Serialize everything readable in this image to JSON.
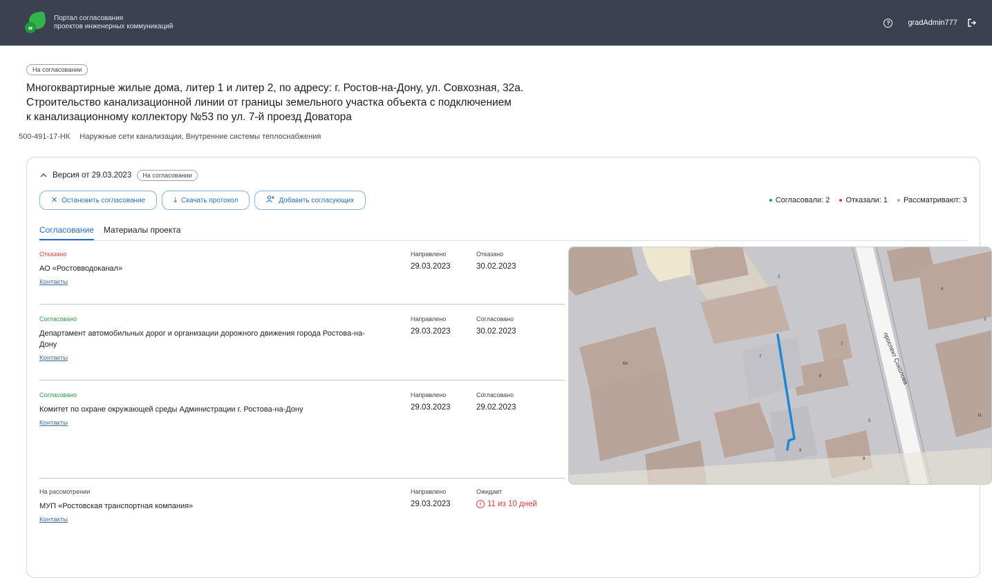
{
  "header": {
    "brand_line1": "Портал согласования",
    "brand_line2": "проектов инженерных коммуникаций",
    "logo_letter": "м",
    "username": "gradAdmin777",
    "icons": [
      "help-icon",
      "logout-icon"
    ]
  },
  "project": {
    "status": "На согласовании",
    "title_line1": "Многоквартирные жилые дома, литер 1 и литер 2, по адресу: г. Ростов-на-Дону, ул. Совхозная, 32а.",
    "title_line2": "Строительство канализационной линии от границы земельного участка объекта с подключением",
    "title_line3": "к канализационному коллектору №53 по ул. 7-й проезд Доватора",
    "code": "500-491-17-НК",
    "systems": "Наружные сети канализации, Внутренние системы теплоснабжения"
  },
  "version": {
    "label": "Версия от 29.03.2023",
    "status": "На согласовании",
    "actions": {
      "stop": "Остановить согласование",
      "download": "Скачать протокол",
      "add": "Добавить согласующих"
    },
    "stats": {
      "approved": "Согласовали: 2",
      "rejected": "Отказали: 1",
      "reviewing": "Рассматривают: 3"
    },
    "colors": {
      "approved": "#2a9d45",
      "rejected": "#e03b3b",
      "reviewing": "#8fb3da",
      "accent": "#1f6fc2"
    }
  },
  "tabs": [
    {
      "label": "Согласование"
    },
    {
      "label": "Материалы проекта"
    }
  ],
  "approvals": [
    {
      "status": "Отказано",
      "status_color": "#e03b3b",
      "org": "АО «Ростовводоканал»",
      "contacts": "Контакты",
      "sent_label": "Направлено",
      "sent": "29.03.2023",
      "result_label": "Отказано",
      "result": "30.02.2023"
    },
    {
      "status": "Согласовано",
      "status_color": "#2a9d45",
      "org": "Департамент автомобильных дорог и организации дорожного движения города Ростова-на-Дону",
      "contacts": "Контакты",
      "sent_label": "Направлено",
      "sent": "29.03.2023",
      "result_label": "Согласовано",
      "result": "30.02.2023"
    },
    {
      "status": "Согласовано",
      "status_color": "#2a9d45",
      "org": "Комитет по охране окружающей среды Администрации г. Ростова-на-Дону",
      "contacts": "Контакты",
      "sent_label": "Направлено",
      "sent": "29.03.2023",
      "result_label": "Согласовано",
      "result": "29.02.2023"
    },
    {
      "status": "На рассмотрении",
      "status_color": "#444444",
      "org": "МУП «Ростовская транспортная компания»",
      "contacts": "Контакты",
      "sent_label": "Направлено",
      "sent": "29.03.2023",
      "result_label": "Ожидает",
      "result": "11 из 10 дней"
    }
  ],
  "map": {
    "street": "проспект Соколова",
    "numbers": [
      "2",
      "4",
      "2",
      "6А",
      "7",
      "7",
      "5",
      "5",
      "9",
      "9",
      "11"
    ]
  }
}
